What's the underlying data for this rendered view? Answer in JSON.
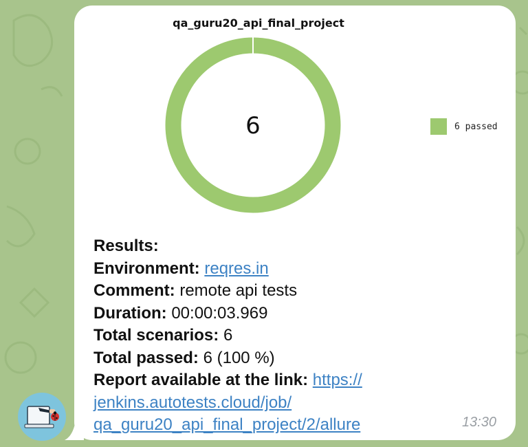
{
  "chart_data": {
    "type": "pie",
    "title": "qa_guru20_api_final_project",
    "center_label": "6",
    "categories": [
      "6 passed"
    ],
    "values": [
      6
    ],
    "colors": [
      "#9dc96f"
    ]
  },
  "report": {
    "results_label": "Results:",
    "environment_label": "Environment:",
    "environment_value": "reqres.in",
    "comment_label": "Comment:",
    "comment_value": "remote api tests",
    "duration_label": "Duration:",
    "duration_value": "00:00:03.969",
    "total_scenarios_label": "Total scenarios:",
    "total_scenarios_value": "6",
    "total_passed_label": "Total passed:",
    "total_passed_value": "6 (100 %)",
    "report_link_label": "Report available at the link:",
    "report_link_line1": "https://",
    "report_link_line2": "jenkins.autotests.cloud/job/",
    "report_link_line3": "qa_guru20_api_final_project/2/allure"
  },
  "message": {
    "time": "13:30"
  },
  "colors": {
    "wallpaper": "#a8c48c",
    "bubble": "#ffffff",
    "passed": "#9dc96f",
    "link": "#3d82c4"
  },
  "icons": {
    "avatar": "bot-avatar-laptop-ladybug-icon"
  }
}
